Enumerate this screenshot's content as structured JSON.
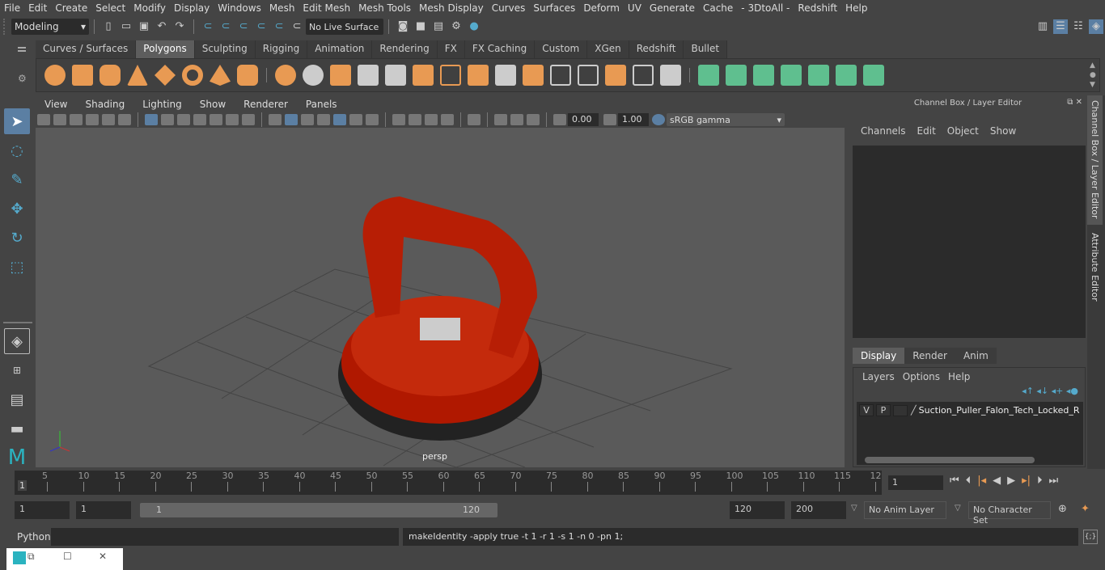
{
  "menubar": {
    "items": [
      "File",
      "Edit",
      "Create",
      "Select",
      "Modify",
      "Display",
      "Windows",
      "Mesh",
      "Edit Mesh",
      "Mesh Tools",
      "Mesh Display",
      "Curves",
      "Surfaces",
      "Deform",
      "UV",
      "Generate",
      "Cache",
      "- 3DtoAll -",
      "Redshift",
      "Help"
    ]
  },
  "status": {
    "mode": "Modeling",
    "live_surface": "No Live Surface"
  },
  "shelf": {
    "tabs": [
      "Curves / Surfaces",
      "Polygons",
      "Sculpting",
      "Rigging",
      "Animation",
      "Rendering",
      "FX",
      "FX Caching",
      "Custom",
      "XGen",
      "Redshift",
      "Bullet"
    ],
    "active": "Polygons"
  },
  "panel": {
    "menus": [
      "View",
      "Shading",
      "Lighting",
      "Show",
      "Renderer",
      "Panels"
    ],
    "exposure": "0.00",
    "gamma": "1.00",
    "color_space": "sRGB gamma",
    "camera": "persp"
  },
  "channel_box": {
    "title": "Channel Box / Layer Editor",
    "menus": [
      "Channels",
      "Edit",
      "Object",
      "Show"
    ]
  },
  "layer_editor": {
    "tabs": [
      "Display",
      "Render",
      "Anim"
    ],
    "active": "Display",
    "menus": [
      "Layers",
      "Options",
      "Help"
    ],
    "layer": {
      "v": "V",
      "p": "P",
      "name": "Suction_Puller_Falon_Tech_Locked_R"
    }
  },
  "side_tabs": [
    "Channel Box / Layer Editor",
    "Attribute Editor"
  ],
  "timeline": {
    "ticks": [
      "5",
      "10",
      "15",
      "20",
      "25",
      "30",
      "35",
      "40",
      "45",
      "50",
      "55",
      "60",
      "65",
      "70",
      "75",
      "80",
      "85",
      "90",
      "95",
      "100",
      "105",
      "110",
      "115",
      "12"
    ],
    "current_marker": "1",
    "current_frame": "1"
  },
  "range": {
    "start": "1",
    "anim_start": "1",
    "slider_start": "1",
    "slider_end": "120",
    "end": "120",
    "anim_end": "200",
    "anim_layer": "No Anim Layer",
    "char_set": "No Character Set"
  },
  "command": {
    "lang": "Python",
    "input": "",
    "output": "makeIdentity -apply true -t 1 -r 1 -s 1 -n 0 -pn 1;"
  }
}
